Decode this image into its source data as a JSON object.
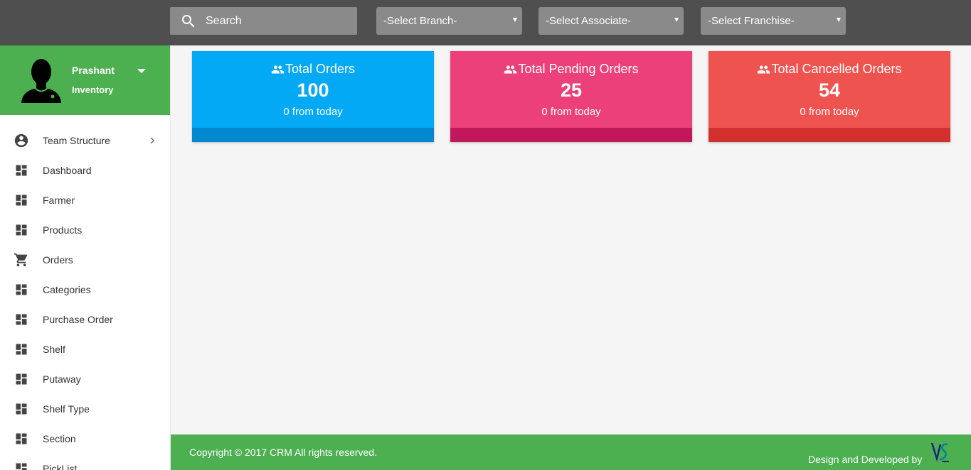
{
  "topbar": {
    "search_label": "Search",
    "branch_select": "-Select Branch-",
    "associate_select": "-Select Associate-",
    "franchise_select": "-Select Franchise-"
  },
  "user": {
    "name": "Prashant",
    "role": "Inventory"
  },
  "sidebar": {
    "items": [
      {
        "label": "Team Structure",
        "icon": "account-circle-icon"
      },
      {
        "label": "Dashboard",
        "icon": "dashboard-icon"
      },
      {
        "label": "Farmer",
        "icon": "dashboard-icon"
      },
      {
        "label": "Products",
        "icon": "dashboard-icon"
      },
      {
        "label": "Orders",
        "icon": "cart-icon"
      },
      {
        "label": "Categories",
        "icon": "dashboard-icon"
      },
      {
        "label": "Purchase Order",
        "icon": "dashboard-icon"
      },
      {
        "label": "Shelf",
        "icon": "dashboard-icon"
      },
      {
        "label": "Putaway",
        "icon": "dashboard-icon"
      },
      {
        "label": "Shelf Type",
        "icon": "dashboard-icon"
      },
      {
        "label": "Section",
        "icon": "dashboard-icon"
      },
      {
        "label": "PickList",
        "icon": "dashboard-icon"
      }
    ]
  },
  "cards": {
    "total": {
      "title": "Total Orders",
      "value": "100",
      "sub": "0 from today",
      "color": "#03a9f4"
    },
    "pending": {
      "title": "Total Pending Orders",
      "value": "25",
      "sub": "0 from today",
      "color": "#ec407a"
    },
    "cancelled": {
      "title": "Total Cancelled Orders",
      "value": "54",
      "sub": "0 from today",
      "color": "#ef5350"
    }
  },
  "footer": {
    "copyright": "Copyright © 2017 CRM All rights reserved.",
    "design": "Design and Developed by",
    "logo_text": "VS"
  }
}
